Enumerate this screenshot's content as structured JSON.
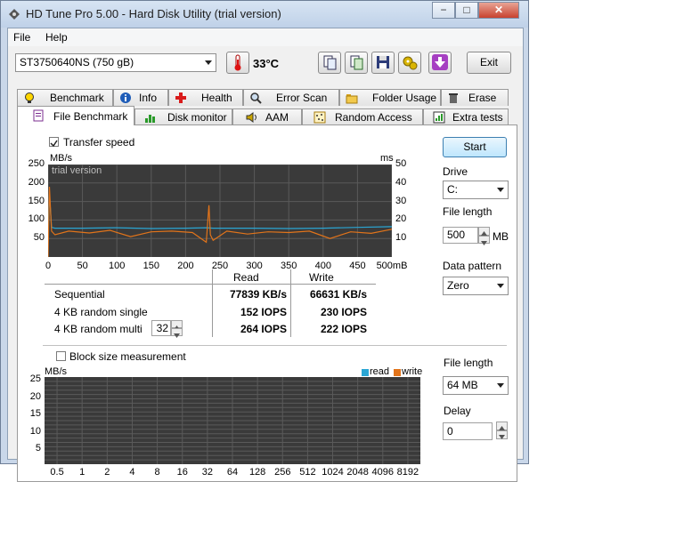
{
  "window": {
    "title": "HD Tune Pro 5.00 - Hard Disk Utility (trial version)",
    "minimize": "−",
    "maximize": "□",
    "close": "✕"
  },
  "menu": {
    "file": "File",
    "help": "Help"
  },
  "toolbar": {
    "disk": "ST3750640NS (750 gB)",
    "temperature": "33°C",
    "exit_label": "Exit"
  },
  "tabs_top": [
    "Benchmark",
    "Info",
    "Health",
    "Error Scan",
    "Folder Usage",
    "Erase"
  ],
  "tabs_bottom": [
    "File Benchmark",
    "Disk monitor",
    "AAM",
    "Random Access",
    "Extra tests"
  ],
  "transfer": {
    "checkbox_label": "Transfer speed",
    "checked": true,
    "y_unit_left": "MB/s",
    "y_unit_right": "ms",
    "watermark": "trial version",
    "y_ticks_left": [
      "250",
      "200",
      "150",
      "100",
      "50"
    ],
    "y_ticks_right": [
      "50",
      "40",
      "30",
      "20",
      "10"
    ],
    "x_ticks": [
      "0",
      "50",
      "100",
      "150",
      "200",
      "250",
      "300",
      "350",
      "400",
      "450",
      "500mB"
    ]
  },
  "results": {
    "col_read": "Read",
    "col_write": "Write",
    "rows": [
      {
        "label": "Sequential",
        "read": "77839 KB/s",
        "write": "66631 KB/s"
      },
      {
        "label": "4 KB random single",
        "read": "152 IOPS",
        "write": "230 IOPS"
      },
      {
        "label": "4 KB random multi",
        "read": "264 IOPS",
        "write": "222 IOPS"
      }
    ],
    "multi_depth": "32"
  },
  "side": {
    "start": "Start",
    "drive_label": "Drive",
    "drive": "C:",
    "file_length_label": "File length",
    "file_length": "500",
    "file_length_unit": "MB",
    "data_pattern_label": "Data pattern",
    "data_pattern": "Zero"
  },
  "block": {
    "checkbox_label": "Block size measurement",
    "checked": false,
    "y_unit": "MB/s",
    "legend_read": "read",
    "legend_write": "write",
    "y_ticks": [
      "25",
      "20",
      "15",
      "10",
      "5"
    ],
    "x_ticks": [
      "0.5",
      "1",
      "2",
      "4",
      "8",
      "16",
      "32",
      "64",
      "128",
      "256",
      "512",
      "1024",
      "2048",
      "4096",
      "8192"
    ],
    "file_length_label": "File length",
    "file_length": "64 MB",
    "delay_label": "Delay",
    "delay": "0"
  },
  "colors": {
    "read_series": "#2aa6d4",
    "write_series": "#e2741a",
    "chart_bg": "#3a3a3a",
    "grid": "#5a5a5a"
  },
  "chart_data": [
    {
      "type": "line",
      "title": "",
      "xlabel": "",
      "ylabel": "MB/s",
      "xlim": [
        0,
        500
      ],
      "ylim": [
        0,
        250
      ],
      "y2lim": [
        0,
        50
      ],
      "grid": true,
      "series": [
        {
          "name": "",
          "axis": "left",
          "x": [
            0,
            2,
            5,
            10,
            50,
            100,
            150,
            200,
            230,
            240,
            250,
            300,
            350,
            400,
            450,
            500
          ],
          "y": [
            75,
            170,
            80,
            78,
            78,
            79,
            77,
            78,
            79,
            78,
            78,
            78,
            77,
            78,
            80,
            82
          ]
        },
        {
          "name": "",
          "axis": "left",
          "x": [
            0,
            2,
            5,
            10,
            30,
            60,
            90,
            120,
            150,
            180,
            210,
            230,
            234,
            236,
            240,
            260,
            290,
            320,
            350,
            380,
            410,
            440,
            470,
            500
          ],
          "y": [
            0,
            190,
            70,
            60,
            70,
            65,
            72,
            55,
            68,
            70,
            66,
            40,
            140,
            60,
            45,
            70,
            62,
            68,
            66,
            70,
            50,
            68,
            64,
            75
          ]
        }
      ]
    },
    {
      "type": "bar",
      "title": "",
      "xlabel": "",
      "ylabel": "MB/s",
      "categories": [
        "0.5",
        "1",
        "2",
        "4",
        "8",
        "16",
        "32",
        "64",
        "128",
        "256",
        "512",
        "1024",
        "2048",
        "4096",
        "8192"
      ],
      "ylim": [
        0,
        25
      ],
      "grid": true,
      "series": [
        {
          "name": "read",
          "values": []
        },
        {
          "name": "write",
          "values": []
        }
      ]
    }
  ]
}
